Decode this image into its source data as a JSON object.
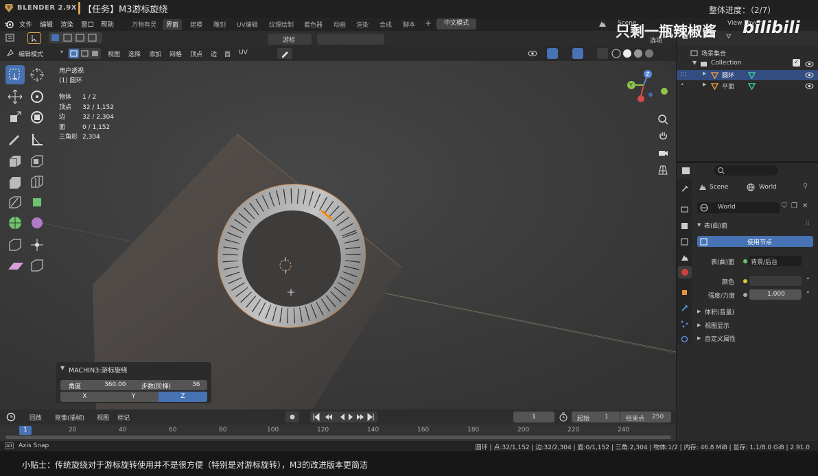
{
  "course": {
    "brand": "BLENDER 2.9X",
    "task": "【任务】M3游标旋绕",
    "progress": "整体进度：（2/7）",
    "watermark_text": "只剩一瓶辣椒酱",
    "watermark_logo": "bilibili"
  },
  "menus": [
    "文件",
    "编辑",
    "渲染",
    "窗口",
    "帮助"
  ],
  "workspaces": [
    "万物有灵",
    "界面",
    "建模",
    "雕刻",
    "UV编辑",
    "纹理绘制",
    "着色器",
    "动画",
    "渲染",
    "合成",
    "脚本"
  ],
  "active_workspace": "界面",
  "lang_button": "中文模式",
  "scene_label": "Scene",
  "viewlayer_label": "View Layer",
  "viewport_header": {
    "mode": "编辑模式",
    "menus": [
      "视图",
      "选择",
      "添加",
      "网格",
      "顶点",
      "边",
      "面",
      "UV"
    ],
    "pivot": "游标",
    "options": "选项"
  },
  "viewport_info": {
    "view": "用户透视",
    "object": "(1) 圆环"
  },
  "stats": [
    {
      "label": "物体",
      "value": "1 / 2"
    },
    {
      "label": "顶点",
      "value": "32 / 1,152"
    },
    {
      "label": "边",
      "value": "32 / 2,304"
    },
    {
      "label": "面",
      "value": "0 / 1,152"
    },
    {
      "label": "三角形",
      "value": "2,304"
    }
  ],
  "operator_panel": {
    "title": "MACHIN3:游标旋绕",
    "angle_label": "角度",
    "angle_value": "360.00",
    "steps_label": "步数(阶梯)",
    "steps_value": "36",
    "axes": [
      "X",
      "Y",
      "Z"
    ],
    "active_axis": "Z"
  },
  "outliner": {
    "root": "场景集合",
    "collection": "Collection",
    "items": [
      {
        "name": "圆环",
        "selected": true
      },
      {
        "name": "平面",
        "selected": false
      }
    ]
  },
  "properties": {
    "search_placeholder": "",
    "breadcrumb_scene": "Scene",
    "breadcrumb_world": "World",
    "world_name": "World",
    "section_surface": "表(曲)面",
    "use_nodes": "使用节点",
    "surface_label": "表(曲)面",
    "surface_value": "背景/后台",
    "color_label": "颜色",
    "strength_label": "强度/力度",
    "strength_value": "1.000",
    "collapsed": [
      "体积(音量)",
      "视图显示",
      "自定义属性"
    ]
  },
  "timeline": {
    "menus": [
      "回放",
      "抠像(插帧)",
      "视图",
      "标记"
    ],
    "current_frame": "1",
    "start_label": "起始",
    "start_value": "1",
    "end_label": "结束点",
    "end_value": "250",
    "ruler": [
      "1",
      "20",
      "40",
      "60",
      "80",
      "100",
      "120",
      "140",
      "160",
      "180",
      "200",
      "220",
      "240"
    ]
  },
  "status": {
    "left": "Axis Snap",
    "right": "圆环 | 点:32/1,152 | 边:32/2,304 | 面:0/1,152 | 三角:2,304 | 物体:1/2 | 内存: 46.8 MiB | 显存: 1.1/8.0 GiB | 2.91.0"
  },
  "subtitle": "小贴士：传统旋绕对于游标旋转使用并不是很方便（特别是对游标旋转），M3的改进版本更简洁",
  "colors": {
    "accent": "#4772b3",
    "selection": "#ff8a00",
    "header": "#232323",
    "panel": "#2b2b2b"
  }
}
